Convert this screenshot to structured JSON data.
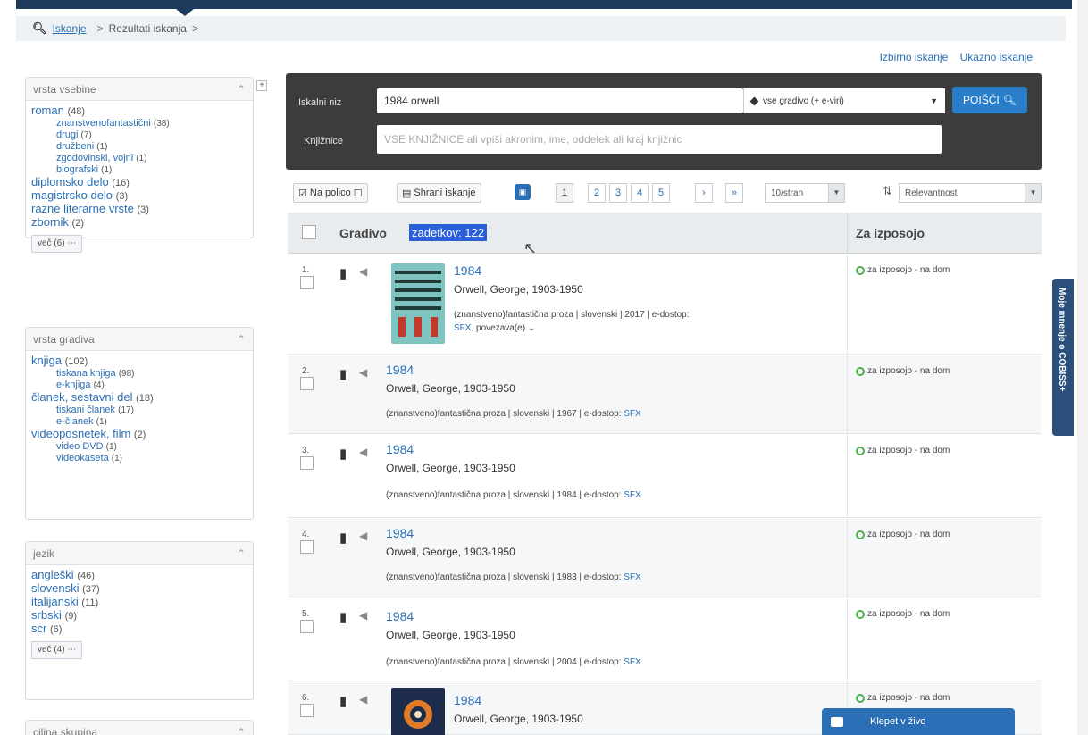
{
  "breadcrumb": {
    "search_link": "Iskanje",
    "current": "Rezultati iskanja"
  },
  "top_links": {
    "select_search": "Izbirno iskanje",
    "command_search": "Ukazno iskanje"
  },
  "facets": {
    "content_type": {
      "title": "vrsta vsebine",
      "items": [
        {
          "label": "roman",
          "count": "(48)",
          "level": 1
        },
        {
          "label": "znanstvenofantastični",
          "count": "(38)",
          "level": 2
        },
        {
          "label": "drugi",
          "count": "(7)",
          "level": 2
        },
        {
          "label": "družbeni",
          "count": "(1)",
          "level": 2
        },
        {
          "label": "zgodovinski, vojni",
          "count": "(1)",
          "level": 2
        },
        {
          "label": "biografski",
          "count": "(1)",
          "level": 2
        },
        {
          "label": "diplomsko delo",
          "count": "(16)",
          "level": 1
        },
        {
          "label": "magistrsko delo",
          "count": "(3)",
          "level": 1
        },
        {
          "label": "razne literarne vrste",
          "count": "(3)",
          "level": 1
        },
        {
          "label": "zbornik",
          "count": "(2)",
          "level": 1
        }
      ],
      "more": "več (6) ⋯"
    },
    "material_type": {
      "title": "vrsta gradiva",
      "items": [
        {
          "label": "knjiga",
          "count": "(102)",
          "level": 1
        },
        {
          "label": "tiskana knjiga",
          "count": "(98)",
          "level": 2
        },
        {
          "label": "e-knjiga",
          "count": "(4)",
          "level": 2
        },
        {
          "label": "članek, sestavni del",
          "count": "(18)",
          "level": 1
        },
        {
          "label": "tiskani članek",
          "count": "(17)",
          "level": 2
        },
        {
          "label": "e-članek",
          "count": "(1)",
          "level": 2
        },
        {
          "label": "videoposnetek, film",
          "count": "(2)",
          "level": 1
        },
        {
          "label": "video DVD",
          "count": "(1)",
          "level": 2
        },
        {
          "label": "videokaseta",
          "count": "(1)",
          "level": 2
        }
      ]
    },
    "language": {
      "title": "jezik",
      "items": [
        {
          "label": "angleški",
          "count": "(46)",
          "level": 1
        },
        {
          "label": "slovenski",
          "count": "(37)",
          "level": 1
        },
        {
          "label": "italijanski",
          "count": "(11)",
          "level": 1
        },
        {
          "label": "srbski",
          "count": "(9)",
          "level": 1
        },
        {
          "label": "scr",
          "count": "(6)",
          "level": 1
        }
      ],
      "more": "več (4) ⋯"
    },
    "target_group": {
      "title": "ciljna skupina"
    }
  },
  "search": {
    "query_label": "Iskalni niz",
    "query_value": "1984 orwell",
    "material_select": "vse gradivo (+ e-viri)",
    "libraries_label": "Knjižnice",
    "libraries_placeholder": "VSE KNJIŽNICE ali vpiši akronim, ime, oddelek ali kraj knjižnic",
    "button": "POIŠČI"
  },
  "toolbar": {
    "shelf": "Na polico",
    "save_search": "Shrani iskanje",
    "pages": [
      "1",
      "2",
      "3",
      "4",
      "5",
      "›",
      "»"
    ],
    "per_page": "10/stran",
    "sort": "Relevantnost"
  },
  "results_header": {
    "material": "Gradivo",
    "hits": "zadetkov: 122",
    "loan": "Za izposojo"
  },
  "results": [
    {
      "num": "1.",
      "title": "1984",
      "author": "Orwell, George, 1903-1950",
      "meta": "(znanstveno)fantastična proza | slovenski | 2017 | e-dostop:",
      "link": "SFX",
      "extra": "povezava(e) ⌄",
      "availability": "za izposojo - na dom"
    },
    {
      "num": "2.",
      "title": "1984",
      "author": "Orwell, George, 1903-1950",
      "meta": "(znanstveno)fantastična proza | slovenski | 1967 | e-dostop:",
      "link": "SFX",
      "availability": "za izposojo - na dom"
    },
    {
      "num": "3.",
      "title": "1984",
      "author": "Orwell, George, 1903-1950",
      "meta": "(znanstveno)fantastična proza | slovenski | 1984 | e-dostop:",
      "link": "SFX",
      "availability": "za izposojo - na dom"
    },
    {
      "num": "4.",
      "title": "1984",
      "author": "Orwell, George, 1903-1950",
      "meta": "(znanstveno)fantastična proza | slovenski | 1983 | e-dostop:",
      "link": "SFX",
      "availability": "za izposojo - na dom"
    },
    {
      "num": "5.",
      "title": "1984",
      "author": "Orwell, George, 1903-1950",
      "meta": "(znanstveno)fantastična proza | slovenski | 2004 | e-dostop:",
      "link": "SFX",
      "availability": "za izposojo - na dom"
    },
    {
      "num": "6.",
      "title": "1984",
      "author": "Orwell, George, 1903-1950",
      "availability": "za izposojo - na dom"
    }
  ],
  "side_tab": "Moje mnenje o COBISS+",
  "chat": "Klepet v živo"
}
